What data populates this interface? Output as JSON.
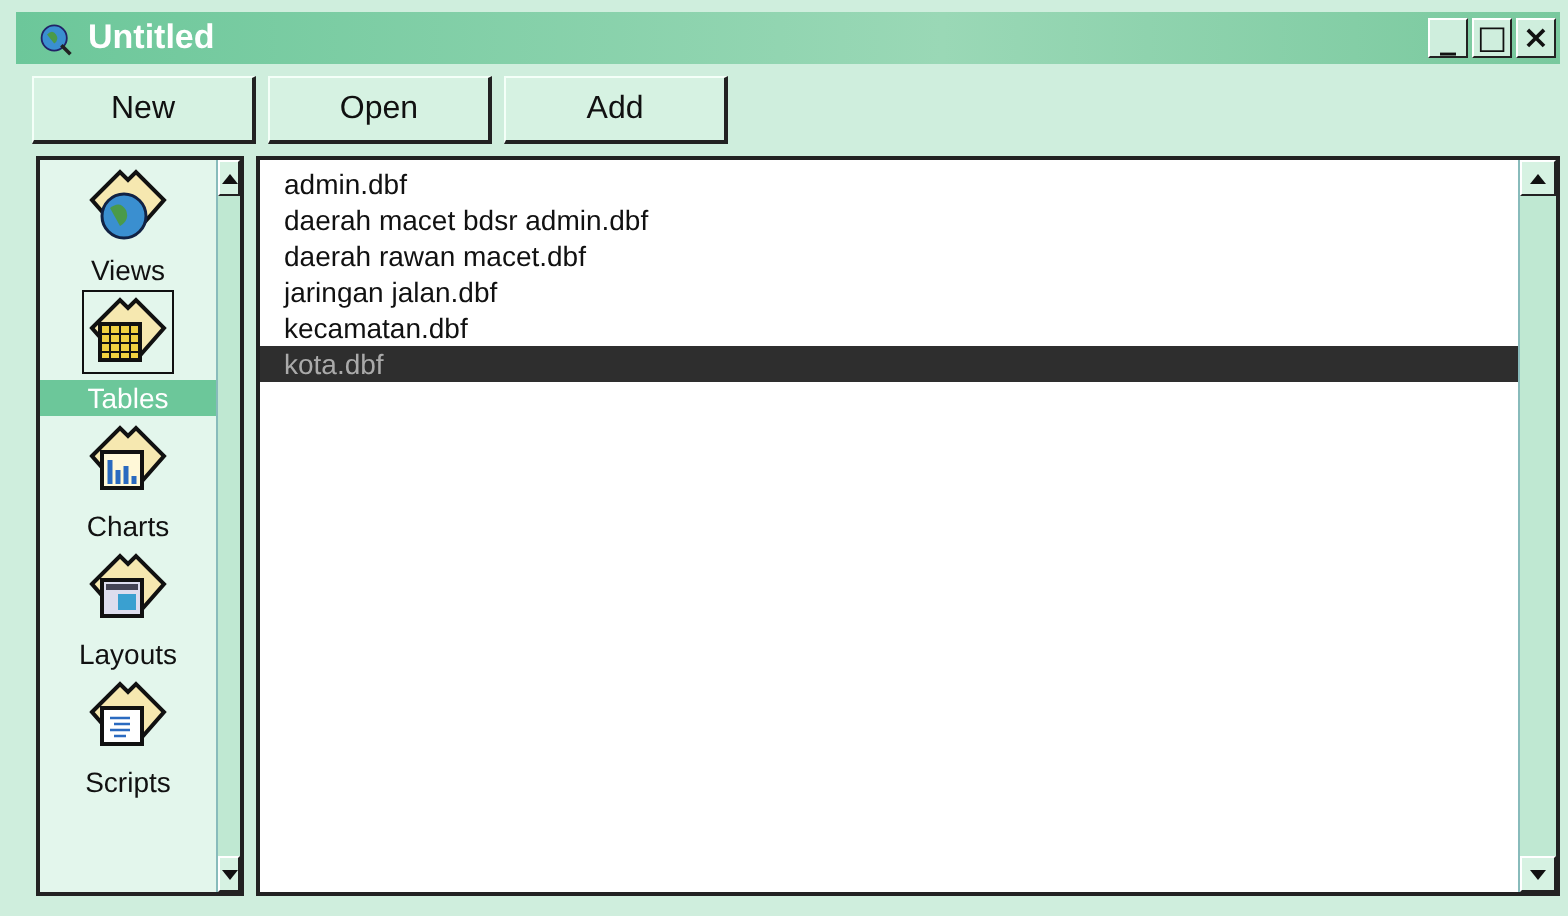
{
  "window": {
    "title": "Untitled",
    "controls": [
      "_",
      "□",
      "×"
    ]
  },
  "toolbar": {
    "buttons": [
      "New",
      "Open",
      "Add"
    ]
  },
  "sidebar": {
    "items": [
      {
        "label": "Views",
        "kind": "views",
        "selected": false
      },
      {
        "label": "Tables",
        "kind": "tables",
        "selected": true
      },
      {
        "label": "Charts",
        "kind": "charts",
        "selected": false
      },
      {
        "label": "Layouts",
        "kind": "layouts",
        "selected": false
      },
      {
        "label": "Scripts",
        "kind": "scripts",
        "selected": false
      }
    ]
  },
  "list": {
    "items": [
      {
        "label": "admin.dbf",
        "selected": false
      },
      {
        "label": "daerah macet bdsr admin.dbf",
        "selected": false
      },
      {
        "label": "daerah rawan macet.dbf",
        "selected": false
      },
      {
        "label": "jaringan jalan.dbf",
        "selected": false
      },
      {
        "label": "kecamatan.dbf",
        "selected": false
      },
      {
        "label": "kota.dbf",
        "selected": true
      }
    ]
  }
}
